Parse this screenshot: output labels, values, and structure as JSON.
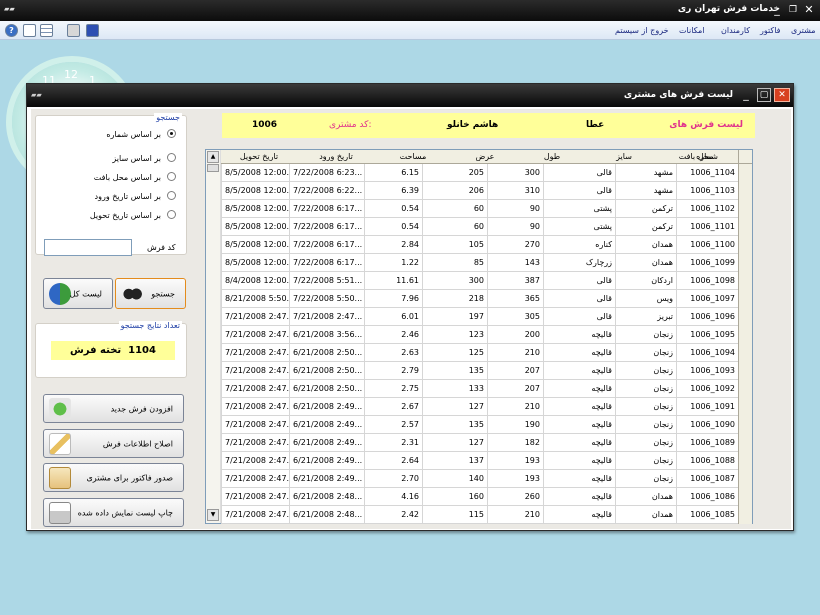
{
  "app": {
    "title": "خدمات فرش تهران ری"
  },
  "menu": [
    "مشتری",
    "فاکتور",
    "کارمندان",
    "امکانات",
    "خروج از سیستم"
  ],
  "clock": {
    "numbers": [
      "12",
      "11",
      "1"
    ]
  },
  "window": {
    "title": "لیست فرش های مشتری"
  },
  "search": {
    "group_title": "جستجو",
    "options": [
      "بر اساس شماره",
      "بر اساس سایز",
      "بر اساس محل بافت",
      "بر اساس تاریخ ورود",
      "بر اساس تاریخ تحویل"
    ],
    "selected_index": 0,
    "code_label": "کد فرش",
    "code_value": "",
    "search_button": "جستجو",
    "list_all_button": "لیست کل"
  },
  "results": {
    "title": "تعداد نتایج جستجو",
    "count": "1104",
    "unit": "تخته فرش"
  },
  "actions": {
    "add": "افزودن فرش جدید",
    "edit": "اصلاح اطلاعات فرش",
    "invoice": "صدور فاکتور برای مشتری",
    "print": "چاپ لیست نمایش داده شده"
  },
  "info": {
    "list_label": "لیست فرش های",
    "first_name": "عطا",
    "last_name": "هاشم خانلو",
    "code_label": "کد مشتری:",
    "code": "1006"
  },
  "grid": {
    "headers": [
      "شماره",
      "محل بافت",
      "سایز",
      "طول",
      "عرض",
      "مساحت",
      "تاریخ ورود",
      "تاریخ تحویل"
    ],
    "rows": [
      [
        "1104_1006",
        "مشهد",
        "قالی",
        "300",
        "205",
        "6.15",
        "7/22/2008 6:23...",
        "8/5/2008 12:00..."
      ],
      [
        "1103_1006",
        "مشهد",
        "قالی",
        "310",
        "206",
        "6.39",
        "7/22/2008 6:22...",
        "8/5/2008 12:00..."
      ],
      [
        "1102_1006",
        "ترکمن",
        "پشتی",
        "90",
        "60",
        "0.54",
        "7/22/2008 6:17...",
        "8/5/2008 12:00..."
      ],
      [
        "1101_1006",
        "ترکمن",
        "پشتی",
        "90",
        "60",
        "0.54",
        "7/22/2008 6:17...",
        "8/5/2008 12:00..."
      ],
      [
        "1100_1006",
        "همدان",
        "کناره",
        "270",
        "105",
        "2.84",
        "7/22/2008 6:17...",
        "8/5/2008 12:00..."
      ],
      [
        "1099_1006",
        "همدان",
        "زرچارک",
        "143",
        "85",
        "1.22",
        "7/22/2008 6:17...",
        "8/5/2008 12:00..."
      ],
      [
        "1098_1006",
        "اردکان",
        "قالی",
        "387",
        "300",
        "11.61",
        "7/22/2008 5:51...",
        "8/4/2008 12:00..."
      ],
      [
        "1097_1006",
        "ویس",
        "قالی",
        "365",
        "218",
        "7.96",
        "7/22/2008 5:50...",
        "8/21/2008 5:50..."
      ],
      [
        "1096_1006",
        "تبریز",
        "قالی",
        "305",
        "197",
        "6.01",
        "7/21/2008 2:47...",
        "7/21/2008 2:47..."
      ],
      [
        "1095_1006",
        "زنجان",
        "قالیچه",
        "200",
        "123",
        "2.46",
        "6/21/2008 3:56...",
        "7/21/2008 2:47..."
      ],
      [
        "1094_1006",
        "زنجان",
        "قالیچه",
        "210",
        "125",
        "2.63",
        "6/21/2008 2:50...",
        "7/21/2008 2:47..."
      ],
      [
        "1093_1006",
        "زنجان",
        "قالیچه",
        "207",
        "135",
        "2.79",
        "6/21/2008 2:50...",
        "7/21/2008 2:47..."
      ],
      [
        "1092_1006",
        "زنجان",
        "قالیچه",
        "207",
        "133",
        "2.75",
        "6/21/2008 2:50...",
        "7/21/2008 2:47..."
      ],
      [
        "1091_1006",
        "زنجان",
        "قالیچه",
        "210",
        "127",
        "2.67",
        "6/21/2008 2:49...",
        "7/21/2008 2:47..."
      ],
      [
        "1090_1006",
        "زنجان",
        "قالیچه",
        "190",
        "135",
        "2.57",
        "6/21/2008 2:49...",
        "7/21/2008 2:47..."
      ],
      [
        "1089_1006",
        "زنجان",
        "قالیچه",
        "182",
        "127",
        "2.31",
        "6/21/2008 2:49...",
        "7/21/2008 2:47..."
      ],
      [
        "1088_1006",
        "زنجان",
        "قالیچه",
        "193",
        "137",
        "2.64",
        "6/21/2008 2:49...",
        "7/21/2008 2:47..."
      ],
      [
        "1087_1006",
        "زنجان",
        "قالیچه",
        "193",
        "140",
        "2.70",
        "6/21/2008 2:49...",
        "7/21/2008 2:47..."
      ],
      [
        "1086_1006",
        "همدان",
        "قالیچه",
        "260",
        "160",
        "4.16",
        "6/21/2008 2:48...",
        "7/21/2008 2:47..."
      ],
      [
        "1085_1006",
        "همدان",
        "قالیچه",
        "210",
        "115",
        "2.42",
        "6/21/2008 2:48...",
        "7/21/2008 2:47..."
      ]
    ]
  },
  "colors": {
    "info_bg": "#ffff99",
    "pink": "#e0328c",
    "accent_blue": "#1f3fa6",
    "close_red": "#d84020"
  }
}
